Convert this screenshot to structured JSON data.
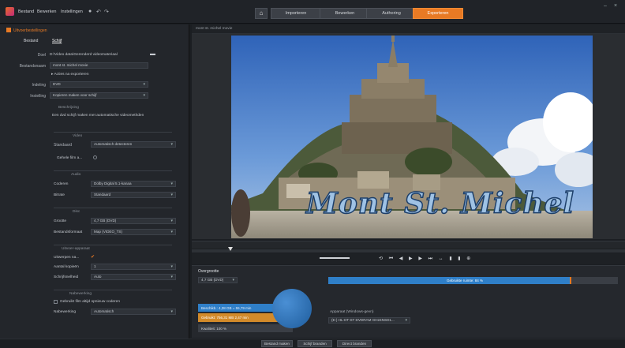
{
  "titlebar": {
    "menus": [
      "Bestand",
      "Bewerken",
      "Instellingen"
    ],
    "tabs": [
      {
        "label": "Importeren",
        "active": false
      },
      {
        "label": "Bewerken",
        "active": false
      },
      {
        "label": "Authoring",
        "active": false
      },
      {
        "label": "Exporteren",
        "active": true
      }
    ]
  },
  "left": {
    "heading": "Uitvoerbestellingen",
    "subtabs": [
      "Bestand",
      "Schijf"
    ],
    "rows": {
      "doel_label": "Doel",
      "doel_value": "D:\\Video data\\Gerenderd videomateriaal",
      "bestandsnaam_label": "Bestandsnaam",
      "bestandsnaam_value": "mont st. michel movie",
      "acties_label": "Acties na exporteren",
      "indeling_label": "Indeling",
      "indeling_value": "DVD",
      "instelling_label": "Instelling",
      "instelling_value": "Kopieren maken voor schijf"
    },
    "beschrijving": {
      "title": "Beschrijving",
      "text": "Een dvd schijf maken met automatische videomethden"
    },
    "video": {
      "title": "Video",
      "standaard_label": "Standaard",
      "standaard_value": "Automatisch detecteren",
      "gehele_label": "Gehele film a..."
    },
    "audio": {
      "title": "Audio",
      "coderen_label": "Coderen",
      "coderen_value": "Dolby Digital 5.1-kanaa",
      "bitrate_label": "Bitrate",
      "bitrate_value": "Standaard"
    },
    "disc": {
      "title": "Disc",
      "grootte_label": "Grootte",
      "grootte_value": "4,7 GB (DVD)",
      "bestandsformaat_label": "Bestandsformaat",
      "bestandsformaat_value": "Map (VIDEO_TS)"
    },
    "uitvoer": {
      "title": "Uitvoer-apparaat",
      "uitwerpen_label": "Uitwerpen na...",
      "aantal_label": "Aantal kopieën",
      "aantal_value": "1",
      "snelheid_label": "Schrijfsnelheid",
      "snelheid_value": "Auto"
    },
    "nabewerking": {
      "title": "Nabewerking",
      "check_label": "Gebruikt film altijd opnieuw coderen",
      "kwaliteit_label": "Nabewerking",
      "kwaliteit_value": "Automatisch"
    }
  },
  "preview": {
    "title": "mont st. michel movie",
    "video_title_text": "Mont St. Michel"
  },
  "bottom": {
    "heading": "Overgrootte",
    "disc_select": "4,7 GB (DVD)",
    "capacity_label": "Gebruikte ruimte: 84 %",
    "capacity_fraction": 0.84,
    "pie": {
      "beschikb": "Beschikb.: 4,38 GB = 55,79 min",
      "gebruikt": "Gebruikt: 756,31 MB  2,47 min",
      "kwaliteit": "Kwaliteit: 100 %"
    },
    "device_label": "Apparaat (Windows-gevn)",
    "device_value": "(E:) HL-DT-ST DVDRAM GH24NSD1..."
  },
  "footer": {
    "buttons": [
      "Bestand maken",
      "Schijf branden",
      "Direct branden"
    ]
  },
  "colors": {
    "accent": "#e87a24",
    "progress": "#2f7fc8",
    "bg": "#1b1e22"
  }
}
